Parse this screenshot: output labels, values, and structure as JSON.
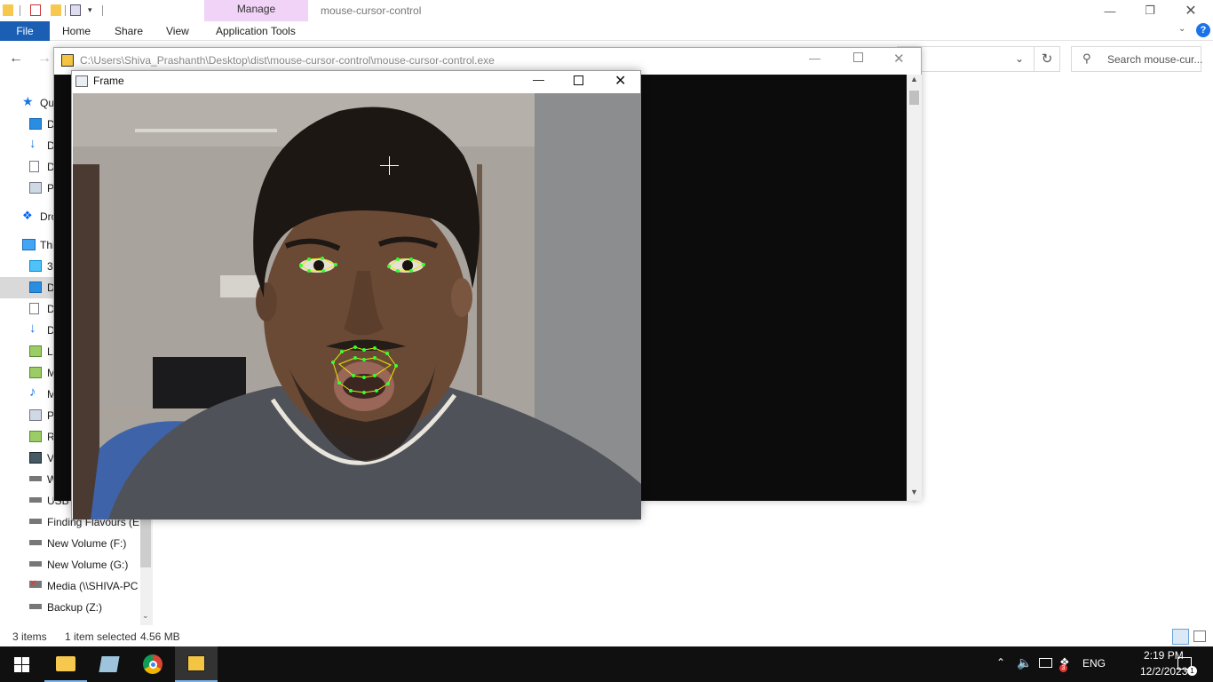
{
  "explorer": {
    "manage_label": "Manage",
    "window_title": "mouse-cursor-control",
    "ribbon_tabs": {
      "file": "File",
      "home": "Home",
      "share": "Share",
      "view": "View",
      "application_tools": "Application Tools"
    },
    "help_label": "?",
    "search_placeholder": "Search mouse-cur...",
    "nav_items": [
      {
        "label": "Qu",
        "icon": "star-icon"
      },
      {
        "label": "D",
        "icon": "desktop-icon"
      },
      {
        "label": "D",
        "icon": "download-icon"
      },
      {
        "label": "D",
        "icon": "document-icon"
      },
      {
        "label": "P",
        "icon": "picture-icon"
      },
      {
        "label": "Dro",
        "icon": "dropbox-icon"
      },
      {
        "label": "Thi",
        "icon": "computer-icon"
      },
      {
        "label": "3",
        "icon": "cube-icon"
      },
      {
        "label": "D",
        "icon": "desktop-icon"
      },
      {
        "label": "D",
        "icon": "document-icon"
      },
      {
        "label": "D",
        "icon": "download-icon"
      },
      {
        "label": "L",
        "icon": "network-drive-icon"
      },
      {
        "label": "M",
        "icon": "network-drive-icon"
      },
      {
        "label": "M",
        "icon": "music-icon"
      },
      {
        "label": "P",
        "icon": "picture-icon"
      },
      {
        "label": "R",
        "icon": "network-drive-icon"
      },
      {
        "label": "V",
        "icon": "video-icon"
      },
      {
        "label": "W",
        "icon": "drive-icon"
      },
      {
        "label": "USB D",
        "icon": "usb-drive-icon"
      },
      {
        "label": "Finding Flavours (E:",
        "icon": "drive-icon"
      },
      {
        "label": "New Volume (F:)",
        "icon": "drive-icon"
      },
      {
        "label": "New Volume (G:)",
        "icon": "drive-icon"
      },
      {
        "label": "Media (\\\\SHIVA-PC",
        "icon": "disconnected-drive-icon"
      },
      {
        "label": "Backup (Z:)",
        "icon": "drive-icon"
      }
    ],
    "status": {
      "items": "3 items",
      "selected": "1 item selected",
      "size": "4.56 MB"
    }
  },
  "console": {
    "title": "C:\\Users\\Shiva_Prashanth\\Desktop\\dist\\mouse-cursor-control\\mouse-cursor-control.exe"
  },
  "frame": {
    "title": "Frame"
  },
  "taskbar": {
    "language": "ENG",
    "time": "2:19 PM",
    "date": "12/2/2023",
    "notification_count": "1",
    "tray_badge": "3"
  },
  "colors": {
    "file_tab": "#1a5fb4",
    "manage_tab": "#f0d3f7",
    "console_bg": "#0c0c0c",
    "taskbar_bg": "#101010",
    "landmark_green": "#33ff33",
    "landmark_yellow": "#e8e800"
  }
}
